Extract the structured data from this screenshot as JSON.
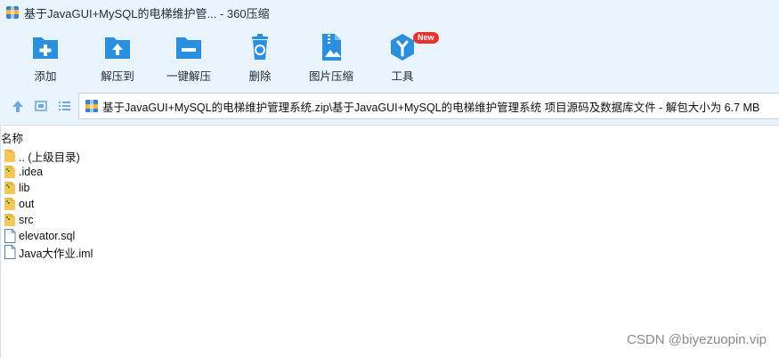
{
  "window": {
    "title": "基于JavaGUI+MySQL的电梯维护管... - 360压缩"
  },
  "toolbar": {
    "items": [
      {
        "id": "add",
        "label": "添加",
        "icon": "add-icon"
      },
      {
        "id": "extract",
        "label": "解压到",
        "icon": "extract-to-icon"
      },
      {
        "id": "oneclick",
        "label": "一键解压",
        "icon": "one-click-extract-icon"
      },
      {
        "id": "delete",
        "label": "删除",
        "icon": "recycle-bin-icon"
      },
      {
        "id": "image",
        "label": "图片压缩",
        "icon": "image-compress-icon"
      },
      {
        "id": "tools",
        "label": "工具",
        "icon": "tools-cube-icon",
        "badge": "New"
      }
    ]
  },
  "address": {
    "path": "基于JavaGUI+MySQL的电梯维护管理系统.zip\\基于JavaGUI+MySQL的电梯维护管理系统 项目源码及数据库文件 - 解包大小为 6.7 MB"
  },
  "list": {
    "header": "名称",
    "items": [
      {
        "name": ".. (上级目录)",
        "type": "folder"
      },
      {
        "name": ".idea",
        "type": "folder"
      },
      {
        "name": "lib",
        "type": "folder"
      },
      {
        "name": "out",
        "type": "folder"
      },
      {
        "name": "src",
        "type": "folder"
      },
      {
        "name": "elevator.sql",
        "type": "file"
      },
      {
        "name": "Java大作业.iml",
        "type": "file"
      }
    ]
  },
  "watermark": "CSDN @biyezuopin.vip",
  "colors": {
    "accent": "#2b8fe0",
    "toolbar_bg": "#eaf4fc",
    "badge": "#e8332d",
    "folder": "#f5c75a"
  }
}
